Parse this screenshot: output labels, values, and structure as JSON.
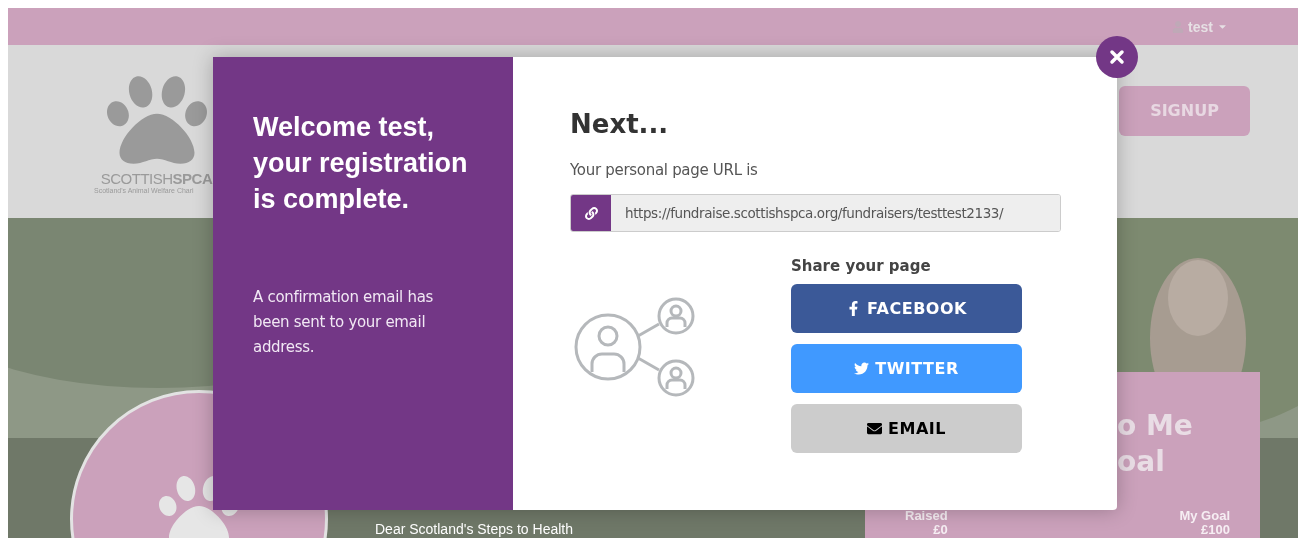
{
  "top_bar": {
    "user_menu": {
      "label": "test"
    }
  },
  "header": {
    "logo": {
      "name": "SCOTTISH**SPCA**",
      "tagline": "Scotland's Animal Welfare Chari"
    },
    "signup_button": "SIGNUP"
  },
  "hero": {
    "caption": "Dear Scotland's Steps to Health",
    "goal_card": {
      "title_lines": [
        "o Me",
        "oal"
      ],
      "stats": [
        {
          "label": "Raised",
          "value": "£0"
        },
        {
          "label": "My Goal",
          "value": "£100"
        }
      ]
    }
  },
  "modal": {
    "welcome": {
      "title": "Welcome test, your registration is complete.",
      "message": "A confirmation email has been sent to your email address."
    },
    "next": {
      "title": "Next...",
      "url_label": "Your personal page URL is",
      "url": "https://fundraise.scottishspca.org/fundraisers/testtest2133/",
      "share_title": "Share your page",
      "share_buttons": [
        {
          "kind": "facebook",
          "label": "FACEBOOK"
        },
        {
          "kind": "twitter",
          "label": "TWITTER"
        },
        {
          "kind": "email",
          "label": "EMAIL"
        }
      ]
    }
  }
}
